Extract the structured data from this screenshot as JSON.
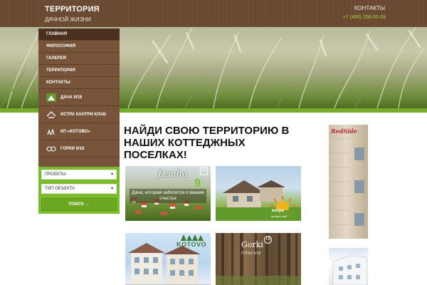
{
  "header": {
    "title": "ТЕРРИТОРИЯ",
    "subtitle": "ДАЧНОЙ ЖИЗНИ",
    "contacts_label": "КОНТАКТЫ",
    "phone": "+7 (495) 256-00-08"
  },
  "nav": {
    "items": [
      {
        "label": "ГЛАВНАЯ"
      },
      {
        "label": "ФИЛОСОФИЯ"
      },
      {
        "label": "ГАЛЕРЕЯ"
      },
      {
        "label": "ТЕРРИТОРИЯ"
      },
      {
        "label": "КОНТАКТЫ"
      }
    ],
    "active": "ГЛАВНАЯ"
  },
  "projects": [
    {
      "label": "ДАЧА 9/18",
      "icon": "dacha-logo-icon"
    },
    {
      "label": "ИСТРА КАНТРИ КЛАБ",
      "icon": "istra-logo-icon"
    },
    {
      "label": "КП «КОТОВО»",
      "icon": "kotovo-logo-icon"
    },
    {
      "label": "ГОРКИ 9/18",
      "icon": "gorki-logo-icon"
    }
  ],
  "filters": {
    "project_select": "ПРОЕКТЫ",
    "type_select": "ТИП ОБЪЕКТА",
    "search_button": "ПОИСК →"
  },
  "main": {
    "headline": "НАЙДИ СВОЮ ТЕРРИТОРИЮ В НАШИХ КОТТЕДЖНЫХ ПОСЕЛКАХ!",
    "tiles": [
      {
        "logo_text": "Dacha",
        "badge": "18",
        "accent": "9",
        "caption": "Дача, которая заботится о вашем счастье"
      },
      {
        "logo_text": "ветра",
        "sub": "кантри клаб"
      },
      {
        "logo_text": "KOTOVO"
      },
      {
        "logo_text": "Gorki",
        "badge": "18",
        "sub": "ГОРКИ 9/18"
      }
    ]
  },
  "banners": {
    "top": {
      "brand": "RedSide"
    }
  },
  "colors": {
    "header_brown": "#6b4a33",
    "sidebar_active": "#4b3020",
    "accent_green": "#7dbb2e",
    "phone_green": "#9fd33a"
  }
}
